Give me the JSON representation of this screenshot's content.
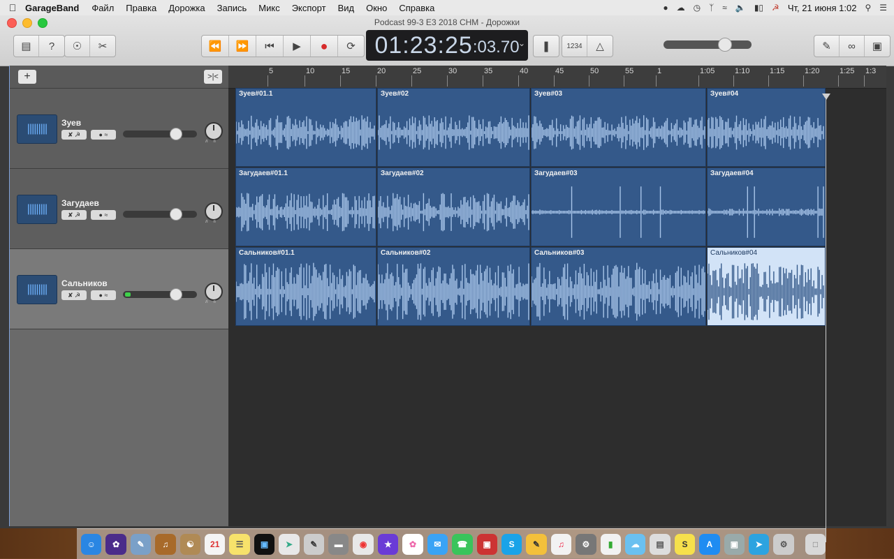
{
  "menubar": {
    "app_name": "GarageBand",
    "items": [
      "Файл",
      "Правка",
      "Дорожка",
      "Запись",
      "Микс",
      "Экспорт",
      "Вид",
      "Окно",
      "Справка"
    ],
    "clock": "Чт, 21 июня  1:02"
  },
  "window": {
    "title": "Podcast 99-3 E3 2018 CHM - Дорожки"
  },
  "lcd": {
    "time_main": "01:23:25",
    "time_frac": ":03.70"
  },
  "toolbar": {
    "count_in_label": "1234"
  },
  "ruler": {
    "ticks": [
      "5",
      "10",
      "15",
      "20",
      "25",
      "30",
      "35",
      "40",
      "45",
      "50",
      "55",
      "1",
      "1:05",
      "1:10",
      "1:15",
      "1:20",
      "1:25",
      "1:3"
    ]
  },
  "tracks": [
    {
      "name": "Зуев",
      "regions": [
        "Зуев#01.1",
        "Зуев#02",
        "Зуев#03",
        "Зуев#04"
      ]
    },
    {
      "name": "Загудаев",
      "regions": [
        "Загудаев#01.1",
        "Загудаев#02",
        "Загудаев#03",
        "Загудаев#04"
      ]
    },
    {
      "name": "Сальников",
      "regions": [
        "Сальников#01.1",
        "Сальников#02",
        "Сальников#03",
        "Сальников#04"
      ]
    }
  ],
  "colors": {
    "region": "#34598a",
    "region_selected": "#d2e3f7",
    "waveform": "#a9c6ea",
    "accent": "#7fa0d8"
  }
}
